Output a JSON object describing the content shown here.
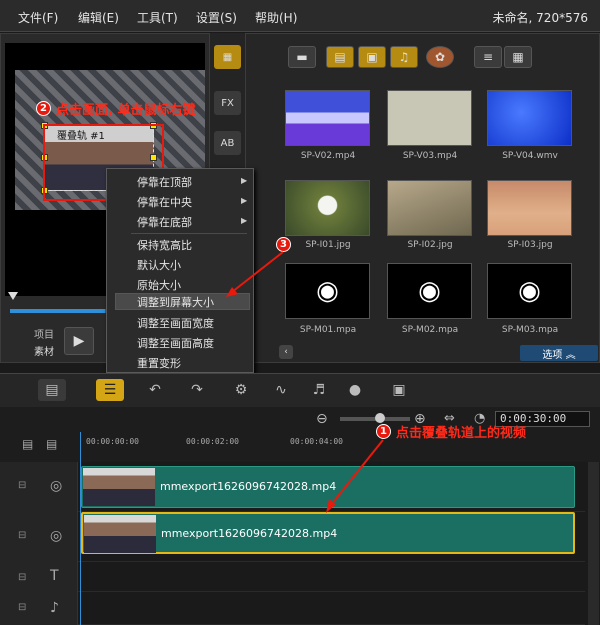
{
  "menu": {
    "items": [
      "文件(F)",
      "编辑(E)",
      "工具(T)",
      "设置(S)",
      "帮助(H)"
    ],
    "project_info": "未命名, 720*576"
  },
  "preview": {
    "overlay_title": "覆叠轨 #1",
    "scrubber_progress": 0.5,
    "project_label": "项目",
    "clip_label": "素材",
    "play_icon": "play-icon"
  },
  "side_toolbar": {
    "media_icon": "media-icon",
    "fx_label": "FX",
    "title_label": "AB"
  },
  "library": {
    "toolbar_icons": [
      "folder-icon",
      "film-icon",
      "image-icon",
      "music-icon",
      "reel-icon",
      "list-view-icon",
      "grid-view-icon"
    ],
    "items": [
      {
        "label": "SP-V02.mp4",
        "kind": "video"
      },
      {
        "label": "SP-V03.mp4",
        "kind": "video"
      },
      {
        "label": "SP-V04.wmv",
        "kind": "video"
      },
      {
        "label": "SP-I01.jpg",
        "kind": "image"
      },
      {
        "label": "SP-I02.jpg",
        "kind": "image"
      },
      {
        "label": "SP-I03.jpg",
        "kind": "image"
      },
      {
        "label": "SP-M01.mpa",
        "kind": "audio"
      },
      {
        "label": "SP-M02.mpa",
        "kind": "audio"
      },
      {
        "label": "SP-M03.mpa",
        "kind": "audio"
      }
    ],
    "options_label": "选项"
  },
  "context_menu": {
    "items": [
      {
        "label": "停靠在顶部",
        "submenu": true
      },
      {
        "label": "停靠在中央",
        "submenu": true
      },
      {
        "label": "停靠在底部",
        "submenu": true
      },
      {
        "label": "保持宽高比",
        "submenu": false
      },
      {
        "label": "默认大小",
        "submenu": false
      },
      {
        "label": "原始大小",
        "submenu": false
      },
      {
        "label": "调整到屏幕大小",
        "submenu": false
      },
      {
        "label": "调整至画面宽度",
        "submenu": false
      },
      {
        "label": "调整至画面高度",
        "submenu": false
      },
      {
        "label": "重置变形",
        "submenu": false
      }
    ],
    "highlighted_index": 6
  },
  "timeline": {
    "timecode": "0:00:30:00",
    "ruler_labels": [
      "00:00:00:00",
      "00:00:02:00",
      "00:00:04:00"
    ],
    "tracks": [
      {
        "name": "video-track",
        "clip": "mmexport1626096742028.mp4"
      },
      {
        "name": "overlay-track",
        "clip": "mmexport1626096742028.mp4"
      },
      {
        "name": "title-track",
        "clip": ""
      },
      {
        "name": "voice-track",
        "clip": ""
      }
    ]
  },
  "annotations": {
    "step1": {
      "badge": "1",
      "text": "点击覆叠轨道上的视频"
    },
    "step2": {
      "badge": "2",
      "text": "点击画面, 单击鼠标右键"
    },
    "step3": {
      "badge": "3"
    },
    "color": "#e8190d"
  }
}
